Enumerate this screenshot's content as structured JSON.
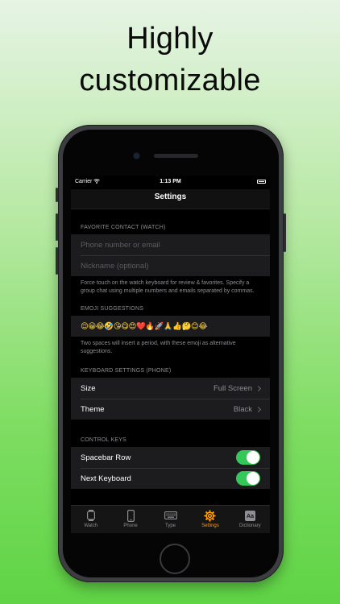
{
  "headline": {
    "line1": "Highly",
    "line2": "customizable"
  },
  "status_bar": {
    "carrier": "Carrier",
    "time": "1:13 PM"
  },
  "nav": {
    "title": "Settings"
  },
  "favorite_contact": {
    "header": "FAVORITE CONTACT (WATCH)",
    "phone_placeholder": "Phone number or email",
    "nickname_placeholder": "Nickname (optional)",
    "note": "Force touch on the watch keyboard for review & favorites. Specify a group chat using multiple numbers and emails separated by commas."
  },
  "emoji_suggestions": {
    "header": "EMOJI SUGGESTIONS",
    "emojis": "😌😀😂🤣😘😋😍❤️🔥🚀🙏👍🤔😊😂",
    "note": "Two spaces will insert a period, with these emoji as alternative suggestions."
  },
  "keyboard_settings": {
    "header": "KEYBOARD SETTINGS (PHONE)",
    "size_label": "Size",
    "size_value": "Full Screen",
    "theme_label": "Theme",
    "theme_value": "Black"
  },
  "control_keys": {
    "header": "CONTROL KEYS",
    "spacebar_label": "Spacebar Row",
    "spacebar_on": true,
    "next_keyboard_label": "Next Keyboard",
    "next_keyboard_on": true
  },
  "tabs": [
    {
      "label": "Watch",
      "icon": "watch-icon",
      "active": false
    },
    {
      "label": "Phone",
      "icon": "phone-icon",
      "active": false
    },
    {
      "label": "Type",
      "icon": "keyboard-icon",
      "active": false
    },
    {
      "label": "Settings",
      "icon": "gear-icon",
      "active": true
    },
    {
      "label": "Dictionary",
      "icon": "dictionary-icon",
      "active": false
    }
  ],
  "colors": {
    "accent": "#ff9f0a",
    "toggle_on": "#34c759",
    "background_green": "#5fd445"
  }
}
